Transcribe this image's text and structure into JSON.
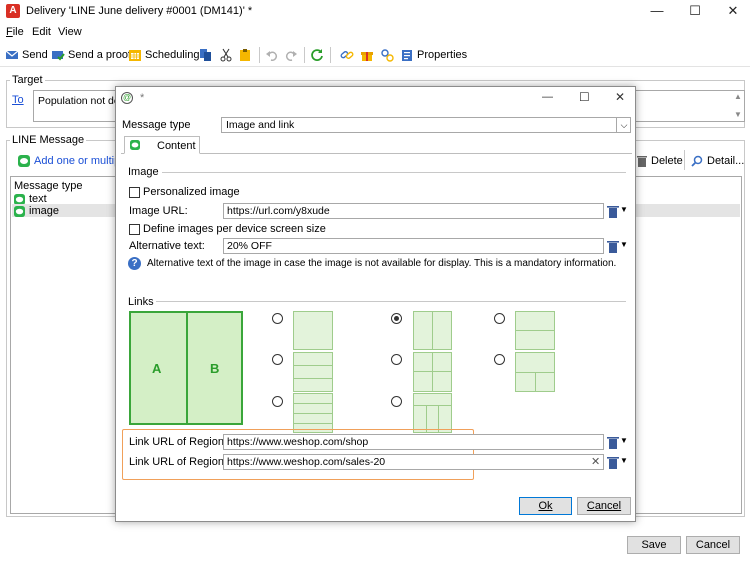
{
  "window": {
    "title": "Delivery 'LINE June delivery #0001 (DM141)' *",
    "minimize": "—",
    "maximize": "☐",
    "close": "✕"
  },
  "menu": {
    "file": "File",
    "edit": "Edit",
    "view": "View"
  },
  "toolbar": {
    "send": "Send",
    "send_proof": "Send a proof",
    "scheduling": "Scheduling",
    "properties": "Properties"
  },
  "target": {
    "group_label": "Target",
    "to_link": "To",
    "population_text": "Population not defined"
  },
  "line_message": {
    "group_label": "LINE Message",
    "add_button": "Add one or multiple",
    "delete_button": "Delete",
    "detail_button": "Detail...",
    "list_header": "Message type",
    "items": [
      "text",
      "image"
    ]
  },
  "footer": {
    "save": "Save",
    "cancel": "Cancel"
  },
  "dialog": {
    "title_suffix": "*",
    "message_type_label": "Message type",
    "message_type_value": "Image and link",
    "tab_content": "Content",
    "image_section": "Image",
    "personalized_image": "Personalized image",
    "image_url_label": "Image URL:",
    "image_url_value": "https://url.com/y8xude",
    "define_images": "Define images per device screen size",
    "alt_text_label": "Alternative text:",
    "alt_text_value": "20% OFF",
    "info_text": "Alternative text of the image in case the image is not available for display. This is a mandatory information.",
    "links_section": "Links",
    "region_a": "A",
    "region_b": "B",
    "link_a_label": "Link URL of Region A:",
    "link_a_value": "https://www.weshop.com/shop",
    "link_b_label": "Link URL of Region B:",
    "link_b_value": "https://www.weshop.com/sales-20",
    "ok": "Ok",
    "cancel": "Cancel"
  },
  "colors": {
    "accent_orange": "#f0a05a",
    "layout_green": "#e3f3db",
    "selected_green": "#c6e8b8",
    "link_blue": "#1a4fd6"
  }
}
